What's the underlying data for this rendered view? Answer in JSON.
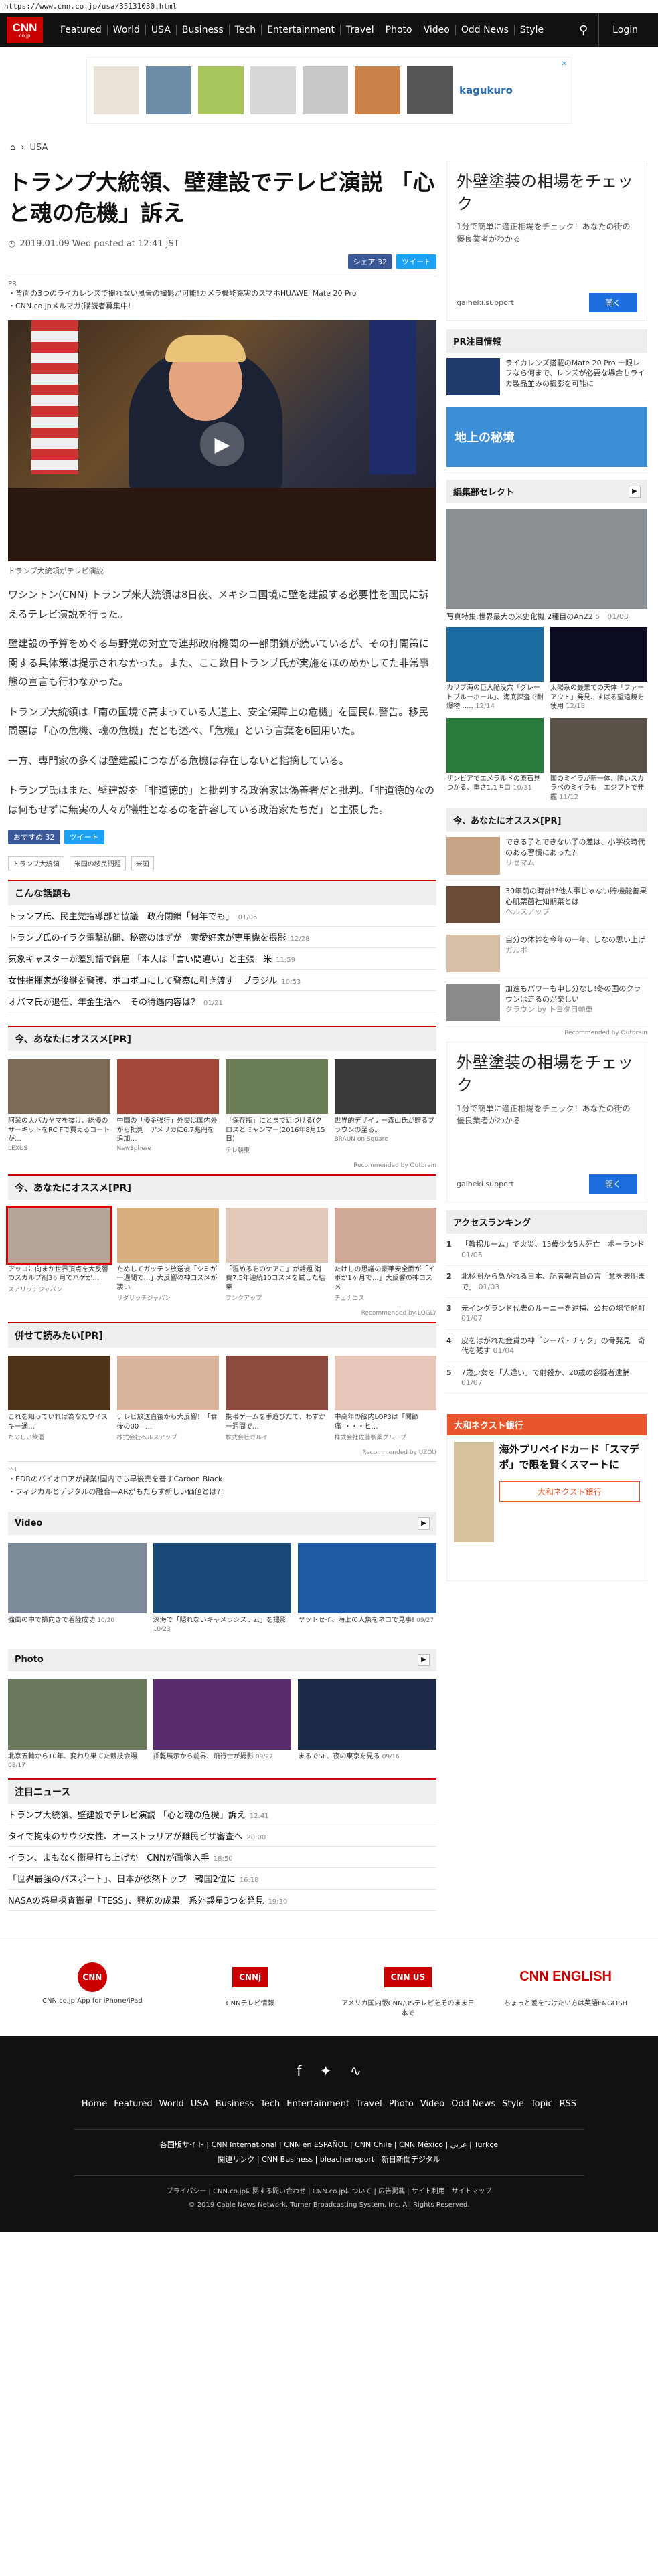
{
  "url": "https://www.cnn.co.jp/usa/35131030.html",
  "nav": {
    "logo": "CNN",
    "logo_sub": "co.jp",
    "links": [
      "Featured",
      "World",
      "USA",
      "Business",
      "Tech",
      "Entertainment",
      "Travel",
      "Photo",
      "Video",
      "Odd News",
      "Style"
    ],
    "login": "Login"
  },
  "top_ad": {
    "badge": "✕",
    "brand": "kagukuro"
  },
  "breadcrumb": {
    "section": "USA"
  },
  "article": {
    "title": "トランプ大統領、壁建設でテレビ演説 「心と魂の危機」訴え",
    "date": "2019.01.09 Wed posted at 12:41 JST",
    "fb_share": "シェア 32",
    "tweet": "ツイート",
    "pr_label": "PR",
    "pr_links": [
      "背面の3つのライカレンズで撮れない風景の撮影が可能!カメラ機能充実のスマホHUAWEI Mate 20 Pro",
      "CNN.co.jpメルマガ(購読者募集中!"
    ],
    "caption": "トランプ大統領がテレビ演説",
    "paragraphs": [
      "ワシントン(CNN) トランプ米大統領は8日夜、メキシコ国境に壁を建設する必要性を国民に訴えるテレビ演説を行った。",
      "壁建設の予算をめぐる与野党の対立で連邦政府機関の一部閉鎖が続いているが、その打開策に関する具体策は提示されなかった。また、ここ数日トランプ氏が実施をほのめかしてた非常事態の宣言も行わなかった。",
      "トランプ大統領は「南の国境で高まっている人道上、安全保障上の危機」を国民に警告。移民問題は「心の危機、魂の危機」だとも述べ、「危機」という言葉を6回用いた。",
      "一方、専門家の多くは壁建設につながる危機は存在しないと指摘している。",
      "トランプ氏はまた、壁建設を「非道徳的」と批判する政治家は偽善者だと批判。「非道徳的なのは何もせずに無実の人々が犠牲となるのを許容している政治家たちだ」と主張した。"
    ],
    "fb_share2": "おすすめ 32",
    "tweet2": "ツイート",
    "tags": [
      "トランプ大統領",
      "米国の移民問題",
      "米国"
    ]
  },
  "topics": {
    "title": "こんな話題も",
    "items": [
      {
        "text": "トランプ氏、民主党指導部と協議　政府閉鎖「何年でも」",
        "time": "01/05"
      },
      {
        "text": "トランプ氏のイラク電撃訪問、秘密のはずが　実愛好家が専用機を撮影",
        "time": "12/28"
      },
      {
        "text": "気象キャスターが差別語で解雇 「本人は「言い間違い」と主張　米",
        "time": "11:59"
      },
      {
        "text": "女性指揮家が後継を警護、ボコボコにして警察に引き渡す　ブラジル",
        "time": "10:53"
      },
      {
        "text": "オバマ氏が退任、年金生活へ　その待遇内容は？",
        "time": "01/21"
      }
    ]
  },
  "pr1": {
    "title": "今、あなたにオススメ[PR]",
    "cards": [
      {
        "text": "阿呆の大バカヤマを抜け、総優のサーキットをRC Fで買えるコートが…",
        "src": "LEXUS"
      },
      {
        "text": "中国の「優金強行」外交は国内外から批判　アメリカに6.7兆円を追加…",
        "src": "NewSphere"
      },
      {
        "text": "「保存瓶」にとまで近づける(クロスとミャンマー(2016年8月15日)",
        "src": "テレ朝東"
      },
      {
        "text": "世界的デザイナー森山氏が贈るブラウンの至る。",
        "src": "BRAUN on Square"
      }
    ],
    "rec": "Recommended by Outbrain"
  },
  "pr2": {
    "title": "今、あなたにオススメ[PR]",
    "cards": [
      {
        "text": "アッコに向まか世界頂点を大反響のスカルプ剤3ヶ月でハゲが…",
        "src": "スアリッチジャパン"
      },
      {
        "text": "ためしてガッテン放送後「シミが一週間で…」大反響の神コスメが凄い",
        "src": "リダリッチジャパン"
      },
      {
        "text": "「湿めるをのケアこ」が話題 消費7.5年連続10コスメを試した結果",
        "src": "フンクアップ"
      },
      {
        "text": "たけしの思議の豪華安全面が「イボが1ヶ月で…」大反響の神コスメ",
        "src": "チェナコス"
      }
    ],
    "rec": "Recommended by LOGLY"
  },
  "pr3": {
    "title": "併せて読みたい[PR]",
    "cards": [
      {
        "text": "これを知っていれば為なたウイスキー通…",
        "src": "たのしい飲酒"
      },
      {
        "text": "テレビ放送直後から大反響！「食後の00—…",
        "src": "株式会社へルスアップ"
      },
      {
        "text": "携帯ゲームを手遊びだて、わずか一週間で…",
        "src": "株式会社ガルイ"
      },
      {
        "text": "中高年の脳内LOP3は「関節痛」・・・ヒ…",
        "src": "株式会社佐藤製薬グループ"
      }
    ],
    "rec": "Recommended by UZOU",
    "pr_label": "PR",
    "pr_links": [
      "EDRのバイオロアが課業!国内でも早後売を普すCarbon Black",
      "フィジカルとデジタルの融合—ARがもたらす新しい価値とは?!"
    ]
  },
  "video": {
    "title": "Video",
    "cards": [
      {
        "text": "強風の中で操向きで着陸成功",
        "time": "10/20"
      },
      {
        "text": "深海で「隠れないキャメラシステム」を撮影",
        "time": "10/23"
      },
      {
        "text": "ヤットセイ、海上の人魚をネコで見事!",
        "time": "09/27"
      }
    ]
  },
  "photo": {
    "title": "Photo",
    "cards": [
      {
        "text": "北京五輪から10年、変わり果てた競技会場",
        "time": "08/17"
      },
      {
        "text": "孫乾展示から前界、飛行士が撮影",
        "time": "09/27"
      },
      {
        "text": "まるでSF、夜の東京を見る",
        "time": "09/16"
      }
    ]
  },
  "bignews": {
    "title": "注目ニュース",
    "items": [
      {
        "text": "トランプ大統領、壁建設でテレビ演説 「心と魂の危機」訴え",
        "time": "12:41"
      },
      {
        "text": "タイで拘束のサウジ女性、オーストラリアが難民ビザ審査へ",
        "time": "20:00"
      },
      {
        "text": "イラン、まもなく衛星打ち上げか　CNNが画像入手",
        "time": "18:50"
      },
      {
        "text": "「世界最強のパスポート」、日本が依然トップ　韓国2位に",
        "time": "16:18"
      },
      {
        "text": "NASAの惑星探査衛星「TESS」、興初の成果　系外惑星3つを発見",
        "time": "19:30"
      }
    ]
  },
  "side_ad": {
    "title": "外壁塗装の相場をチェック",
    "sub": "1分で簡単に適正相場をチェック！あなたの街の優良業者がわかる",
    "domain": "gaiheki.support",
    "btn": "開く"
  },
  "side_pr": {
    "title": "PR注目情報",
    "items": [
      {
        "text": "ライカレンズ搭載のMate 20 Pro 一眼レフなら何まで、レンズが必要な場合もライカ製品並みの撮影を可能に"
      },
      {
        "text": "地上の秘境"
      }
    ]
  },
  "editors": {
    "title": "編集部セレクト",
    "main_caption": "写真特集:世界最大の米史化機,2種目のAn22",
    "main_time": "5　01/03",
    "items": [
      {
        "text": "カリブ海の巨大陥没穴「グレートブルーホール」、海底探査で耐爆物……",
        "time": "12/14"
      },
      {
        "text": "太陽系の最果ての天体「ファーアウト」発見、すばる望遠鏡を使用",
        "time": "12/18"
      },
      {
        "text": "ザンビアでエメラルドの原石見つかる、重さ1,1キロ",
        "time": "10/31"
      },
      {
        "text": "国のミイラが新一体、隣いスカラベのミイラも　エジプトで発掘",
        "time": "11/12"
      }
    ]
  },
  "side_pr2": {
    "title": "今、あなたにオススメ[PR]",
    "items": [
      {
        "text": "できる子とできない子の差は、小学校時代のある習慣にあった？",
        "src": "リセマム"
      },
      {
        "text": "30年前の時計!?他人事じゃない貯機能善果心肌栗菌社知期菜とは",
        "src": "ヘルスアップ"
      },
      {
        "text": "自分の体幹を今年の一年、しなの思い上げ",
        "src": "ガルボ"
      },
      {
        "text": "加速もパワーも申し分なし!冬の国のクラウンは走るのが楽しい",
        "src": "クラウン by トヨタ自動車"
      }
    ],
    "rec": "Recommended by Outbrain"
  },
  "ranking": {
    "title": "アクセスランキング",
    "items": [
      {
        "n": "1",
        "text": "「教拐ルーム」で火災、15歳少女5人死亡　ポーランド",
        "time": "01/05"
      },
      {
        "text": "北極圏から急がれる日本、記者報言員の言「意を表明まで」",
        "n": "2",
        "time": "01/03"
      },
      {
        "n": "3",
        "text": "元イングランド代表のルーニーを逮捕、公共の場で酩酊",
        "time": "01/07"
      },
      {
        "n": "4",
        "text": "皮をはがれた金貨の神「シーパ・チャク」の骨発見　奇代を残す",
        "time": "01/04"
      },
      {
        "n": "5",
        "text": "7歳少女を「人違い」で射殺か、20歳の容疑者逮捕",
        "time": "01/07"
      }
    ]
  },
  "side_ad2": {
    "banner": "大和ネクスト銀行",
    "headline": "海外プリペイドカード「スマデポ」で限を賢くスマートに",
    "btn": "大和ネクスト銀行"
  },
  "apps": [
    {
      "name": "CNN.co.jp App for iPhone/iPad"
    },
    {
      "name": "CNNテレビ情報"
    },
    {
      "name": "アメリカ国内版CNN/USテレビをそのまま日本で"
    },
    {
      "name": "ちょっと差をつけたい方は英語ENGLISH"
    }
  ],
  "footer": {
    "nav": [
      "Home",
      "Featured",
      "World",
      "USA",
      "Business",
      "Tech",
      "Entertainment",
      "Travel",
      "Photo",
      "Video",
      "Odd News",
      "Style",
      "Topic",
      "RSS"
    ],
    "editions": [
      "各国版サイト",
      "CNN International",
      "CNN en ESPAÑOL",
      "CNN Chile",
      "CNN México",
      "عربي",
      "Türkçe",
      "関連リンク",
      "CNN Business",
      "bleacherreport",
      "新日新聞デジタル"
    ],
    "legal": [
      "プライバシー",
      "CNN.co.jpに関する問い合わせ",
      "CNN.co.jpについて",
      "広告掲載",
      "サイト利用",
      "サイトマップ"
    ],
    "copyright": "© 2019 Cable News Network. Turner Broadcasting System, Inc. All Rights Reserved."
  }
}
